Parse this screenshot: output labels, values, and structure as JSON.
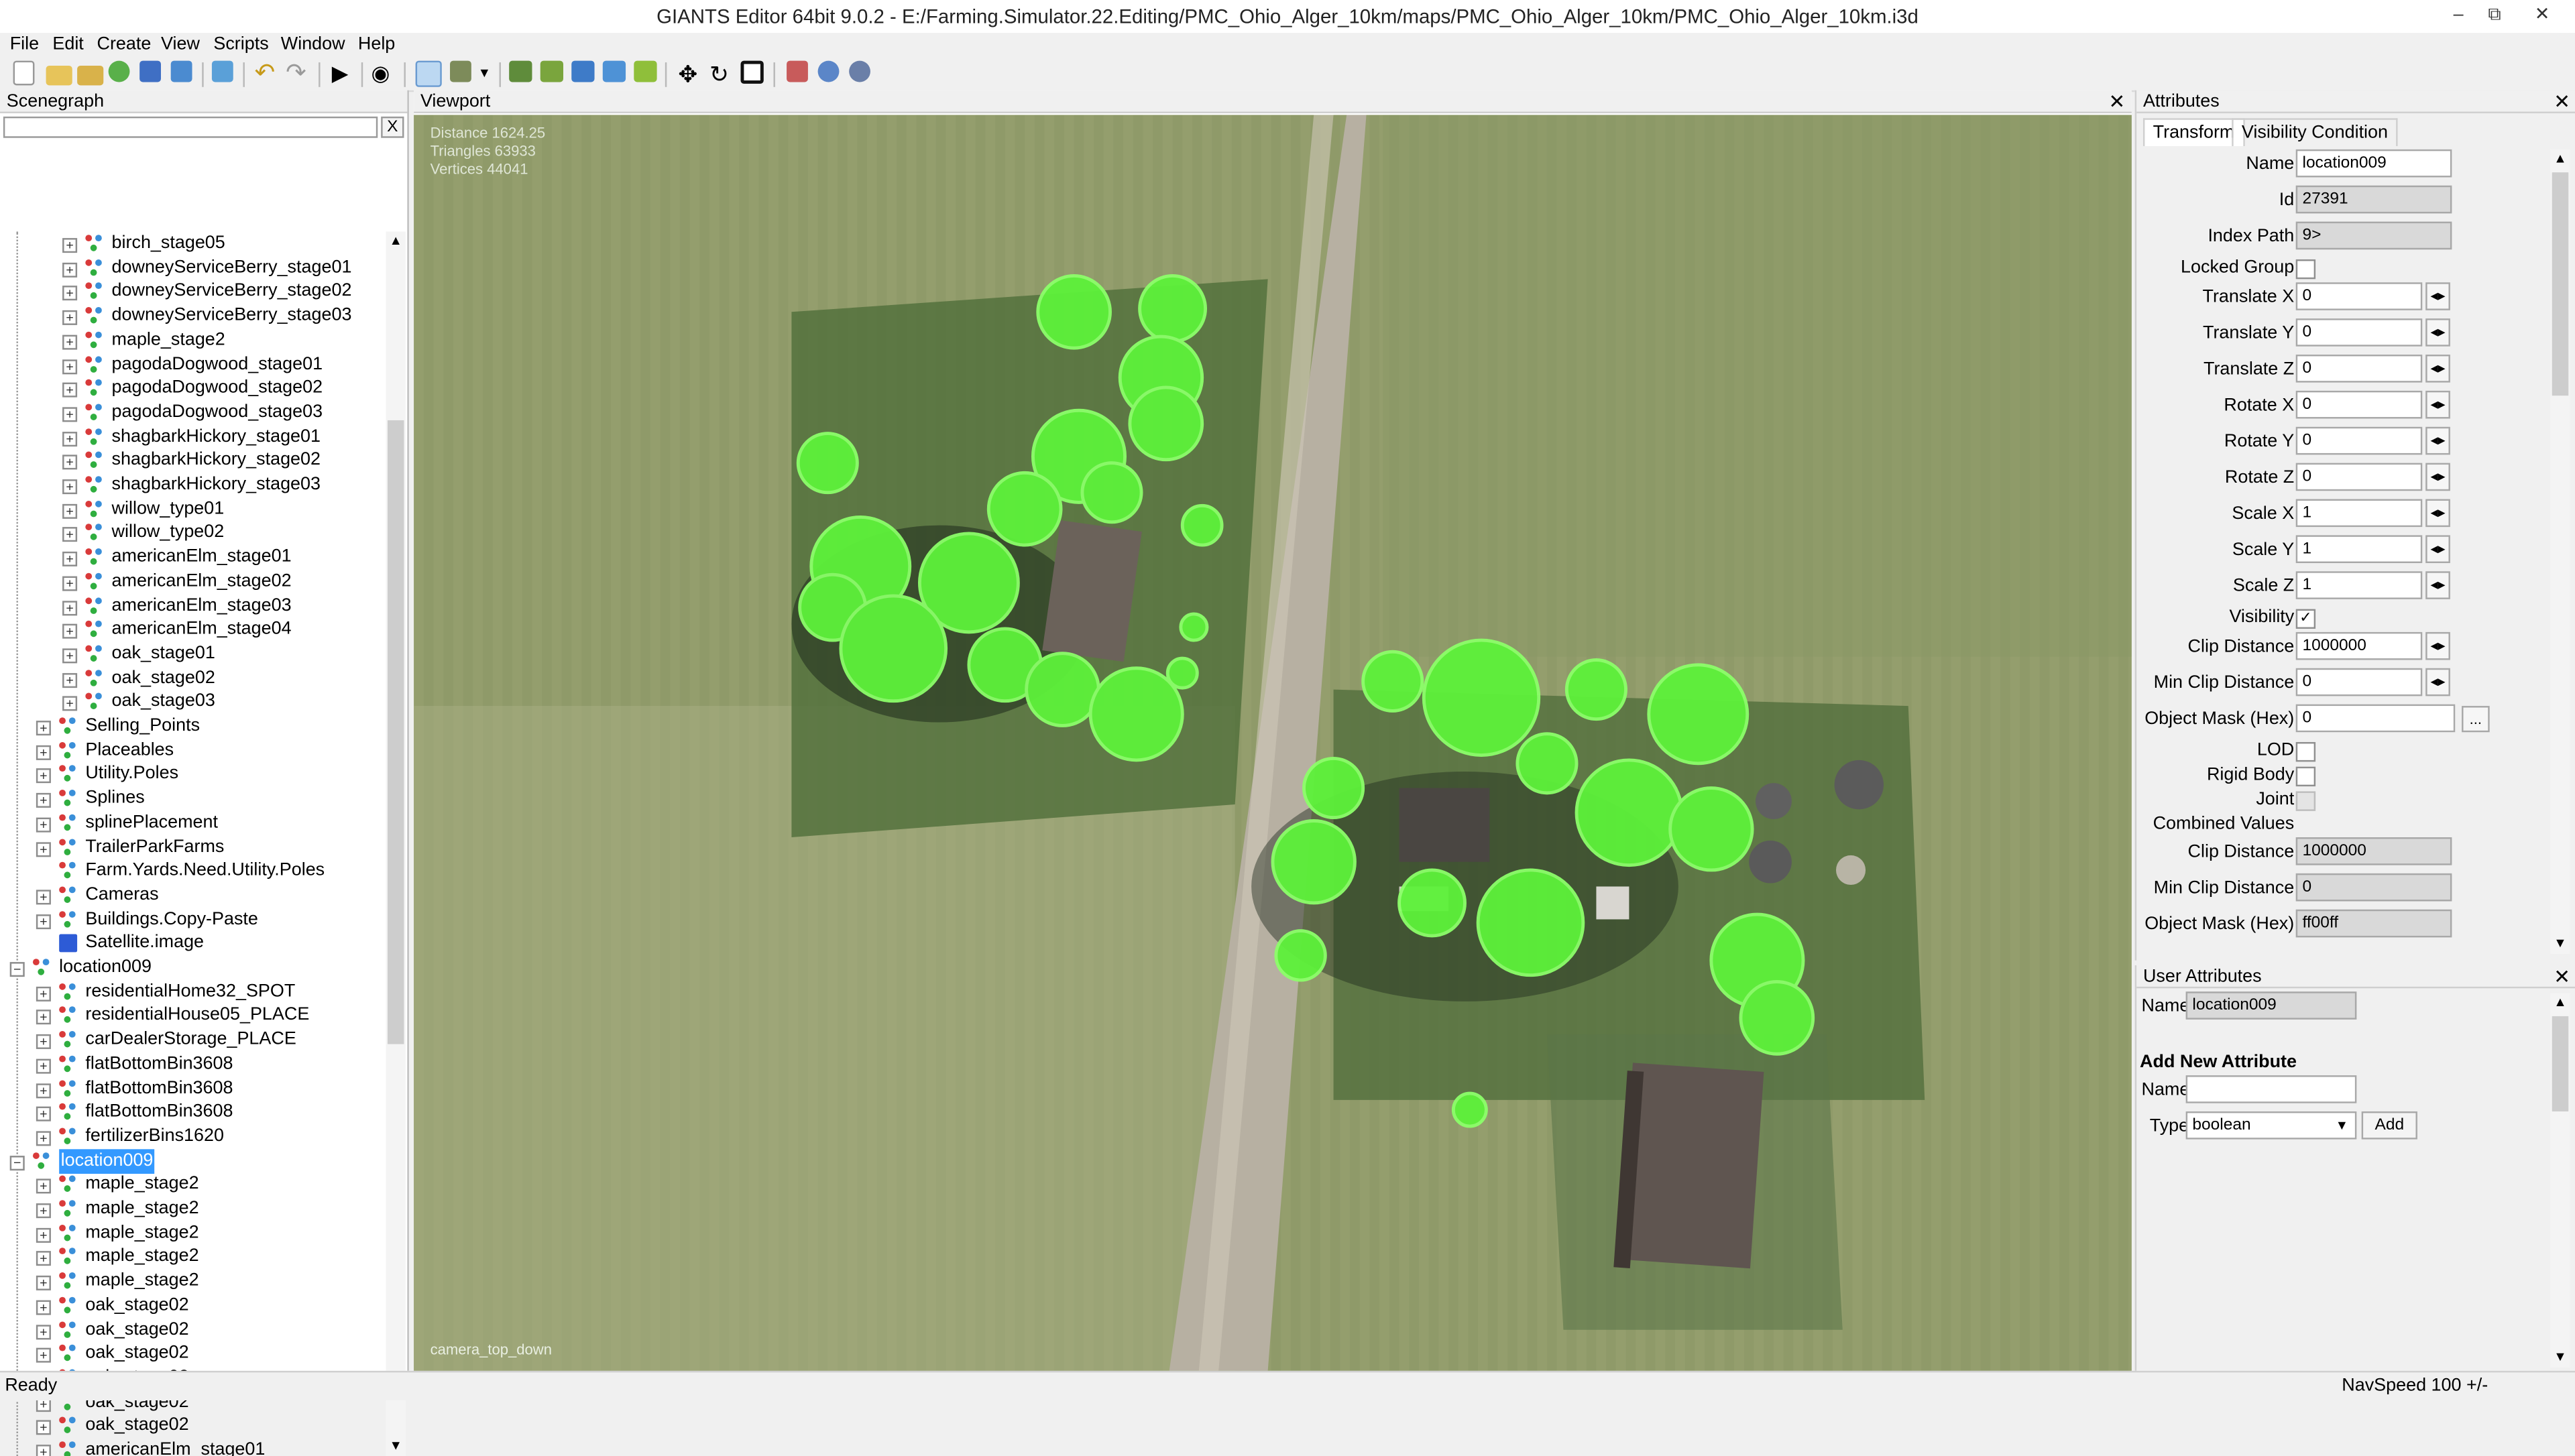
{
  "window": {
    "title": "GIANTS Editor 64bit 9.0.2 - E:/Farming.Simulator.22.Editing/PMC_Ohio_Alger_10km/maps/PMC_Ohio_Alger_10km/PMC_Ohio_Alger_10km.i3d",
    "minimize": "–",
    "restore": "⧉",
    "close": "✕"
  },
  "menu": [
    "File",
    "Edit",
    "Create",
    "View",
    "Scripts",
    "Window",
    "Help"
  ],
  "toolbar": {
    "icons": [
      "new-file-icon",
      "open-folder-icon",
      "open-recent-icon",
      "reload-icon",
      "save-icon",
      "save-as-icon",
      "import-icon",
      "undo-icon",
      "redo-icon",
      "play-icon",
      "eye-icon",
      "select-mode-icon",
      "terrain-sculpt-icon",
      "dropdown-arrow-icon",
      "paint-terrain-icon",
      "foliage-paint-icon",
      "decal-paint-icon",
      "info-layer-icon",
      "foliage-mode-icon",
      "move-icon",
      "rotate-icon",
      "scale-icon",
      "object-tools-icon",
      "settings-icon",
      "scripts-icon"
    ]
  },
  "scenegraph": {
    "title": "Scenegraph",
    "clear_label": "X",
    "filter_value": "",
    "rows": [
      {
        "label": "birch_stage05",
        "depth": 3,
        "expander": "+",
        "icon": "tg"
      },
      {
        "label": "downeyServiceBerry_stage01",
        "depth": 3,
        "expander": "+",
        "icon": "tg"
      },
      {
        "label": "downeyServiceBerry_stage02",
        "depth": 3,
        "expander": "+",
        "icon": "tg"
      },
      {
        "label": "downeyServiceBerry_stage03",
        "depth": 3,
        "expander": "+",
        "icon": "tg"
      },
      {
        "label": "maple_stage2",
        "depth": 3,
        "expander": "+",
        "icon": "tg"
      },
      {
        "label": "pagodaDogwood_stage01",
        "depth": 3,
        "expander": "+",
        "icon": "tg"
      },
      {
        "label": "pagodaDogwood_stage02",
        "depth": 3,
        "expander": "+",
        "icon": "tg"
      },
      {
        "label": "pagodaDogwood_stage03",
        "depth": 3,
        "expander": "+",
        "icon": "tg"
      },
      {
        "label": "shagbarkHickory_stage01",
        "depth": 3,
        "expander": "+",
        "icon": "tg"
      },
      {
        "label": "shagbarkHickory_stage02",
        "depth": 3,
        "expander": "+",
        "icon": "tg"
      },
      {
        "label": "shagbarkHickory_stage03",
        "depth": 3,
        "expander": "+",
        "icon": "tg"
      },
      {
        "label": "willow_type01",
        "depth": 3,
        "expander": "+",
        "icon": "tg"
      },
      {
        "label": "willow_type02",
        "depth": 3,
        "expander": "+",
        "icon": "tg"
      },
      {
        "label": "americanElm_stage01",
        "depth": 3,
        "expander": "+",
        "icon": "tg"
      },
      {
        "label": "americanElm_stage02",
        "depth": 3,
        "expander": "+",
        "icon": "tg"
      },
      {
        "label": "americanElm_stage03",
        "depth": 3,
        "expander": "+",
        "icon": "tg"
      },
      {
        "label": "americanElm_stage04",
        "depth": 3,
        "expander": "+",
        "icon": "tg"
      },
      {
        "label": "oak_stage01",
        "depth": 3,
        "expander": "+",
        "icon": "tg"
      },
      {
        "label": "oak_stage02",
        "depth": 3,
        "expander": "+",
        "icon": "tg"
      },
      {
        "label": "oak_stage03",
        "depth": 3,
        "expander": "+",
        "icon": "tg"
      },
      {
        "label": "Selling_Points",
        "depth": 2,
        "expander": "+",
        "icon": "tg"
      },
      {
        "label": "Placeables",
        "depth": 2,
        "expander": "+",
        "icon": "tg"
      },
      {
        "label": "Utility.Poles",
        "depth": 2,
        "expander": "+",
        "icon": "tg"
      },
      {
        "label": "Splines",
        "depth": 2,
        "expander": "+",
        "icon": "tg"
      },
      {
        "label": "splinePlacement",
        "depth": 2,
        "expander": "+",
        "icon": "tg"
      },
      {
        "label": "TrailerParkFarms",
        "depth": 2,
        "expander": "+",
        "icon": "tg"
      },
      {
        "label": "Farm.Yards.Need.Utility.Poles",
        "depth": 2,
        "expander": "",
        "icon": "tg"
      },
      {
        "label": "Cameras",
        "depth": 2,
        "expander": "+",
        "icon": "tg"
      },
      {
        "label": "Buildings.Copy-Paste",
        "depth": 2,
        "expander": "+",
        "icon": "tg"
      },
      {
        "label": "Satellite.image",
        "depth": 2,
        "expander": "",
        "icon": "shape"
      },
      {
        "label": "location009",
        "depth": 1,
        "expander": "−",
        "icon": "tg"
      },
      {
        "label": "residentialHome32_SPOT",
        "depth": 2,
        "expander": "+",
        "icon": "tg"
      },
      {
        "label": "residentialHouse05_PLACE",
        "depth": 2,
        "expander": "+",
        "icon": "tg"
      },
      {
        "label": "carDealerStorage_PLACE",
        "depth": 2,
        "expander": "+",
        "icon": "tg"
      },
      {
        "label": "flatBottomBin3608",
        "depth": 2,
        "expander": "+",
        "icon": "tg"
      },
      {
        "label": "flatBottomBin3608",
        "depth": 2,
        "expander": "+",
        "icon": "tg"
      },
      {
        "label": "flatBottomBin3608",
        "depth": 2,
        "expander": "+",
        "icon": "tg"
      },
      {
        "label": "fertilizerBins1620",
        "depth": 2,
        "expander": "+",
        "icon": "tg"
      },
      {
        "label": "location009",
        "depth": 1,
        "expander": "−",
        "icon": "tg",
        "selected": true
      },
      {
        "label": "maple_stage2",
        "depth": 2,
        "expander": "+",
        "icon": "tg"
      },
      {
        "label": "maple_stage2",
        "depth": 2,
        "expander": "+",
        "icon": "tg"
      },
      {
        "label": "maple_stage2",
        "depth": 2,
        "expander": "+",
        "icon": "tg"
      },
      {
        "label": "maple_stage2",
        "depth": 2,
        "expander": "+",
        "icon": "tg"
      },
      {
        "label": "maple_stage2",
        "depth": 2,
        "expander": "+",
        "icon": "tg"
      },
      {
        "label": "oak_stage02",
        "depth": 2,
        "expander": "+",
        "icon": "tg"
      },
      {
        "label": "oak_stage02",
        "depth": 2,
        "expander": "+",
        "icon": "tg"
      },
      {
        "label": "oak_stage02",
        "depth": 2,
        "expander": "+",
        "icon": "tg"
      },
      {
        "label": "oak_stage02",
        "depth": 2,
        "expander": "+",
        "icon": "tg"
      },
      {
        "label": "oak_stage02",
        "depth": 2,
        "expander": "+",
        "icon": "tg"
      },
      {
        "label": "oak_stage02",
        "depth": 2,
        "expander": "+",
        "icon": "tg"
      },
      {
        "label": "americanElm_stage01",
        "depth": 2,
        "expander": "+",
        "icon": "tg"
      }
    ]
  },
  "viewport": {
    "title": "Viewport",
    "stats": {
      "distance": "Distance 1624.25",
      "triangles": "Triangles 63933",
      "vertices": "Vertices 44041"
    },
    "camera_label": "camera_top_down"
  },
  "attributes": {
    "title": "Attributes",
    "tabs": [
      "Transform",
      "Visibility Condition"
    ],
    "labels": {
      "name": "Name",
      "id": "Id",
      "index_path": "Index Path",
      "locked_group": "Locked Group",
      "translate_x": "Translate X",
      "translate_y": "Translate Y",
      "translate_z": "Translate Z",
      "rotate_x": "Rotate X",
      "rotate_y": "Rotate Y",
      "rotate_z": "Rotate Z",
      "scale_x": "Scale X",
      "scale_y": "Scale Y",
      "scale_z": "Scale Z",
      "visibility": "Visibility",
      "clip_distance": "Clip Distance",
      "min_clip_distance": "Min Clip Distance",
      "object_mask": "Object Mask (Hex)",
      "lod": "LOD",
      "rigid_body": "Rigid Body",
      "joint": "Joint",
      "combined_values": "Combined Values",
      "c_clip_distance": "Clip Distance",
      "c_min_clip_distance": "Min Clip Distance",
      "c_object_mask": "Object Mask (Hex)"
    },
    "values": {
      "name": "location009",
      "id": "27391",
      "index_path": "9>",
      "translate_x": "0",
      "translate_y": "0",
      "translate_z": "0",
      "rotate_x": "0",
      "rotate_y": "0",
      "rotate_z": "0",
      "scale_x": "1",
      "scale_y": "1",
      "scale_z": "1",
      "clip_distance": "1000000",
      "min_clip_distance": "0",
      "object_mask": "0",
      "c_clip_distance": "1000000",
      "c_min_clip_distance": "0",
      "c_object_mask": "ff00ff"
    },
    "checks": {
      "locked_group": false,
      "visibility": true,
      "lod": false,
      "rigid_body": false,
      "joint": false
    },
    "stepper_label": "◂▸",
    "ellipsis": "..."
  },
  "user_attributes": {
    "title": "User Attributes",
    "name_label": "Name",
    "name_value": "location009",
    "add_heading": "Add New Attribute",
    "new_name_label": "Name",
    "new_name_value": "",
    "type_label": "Type",
    "type_value": "boolean",
    "add_button": "Add"
  },
  "statusbar": {
    "status": "Ready",
    "navspeed": "NavSpeed 100 +/-"
  },
  "colors": {
    "selection": "#3399ff",
    "foliage": "#5df23a",
    "field": "#8e9a6a"
  }
}
